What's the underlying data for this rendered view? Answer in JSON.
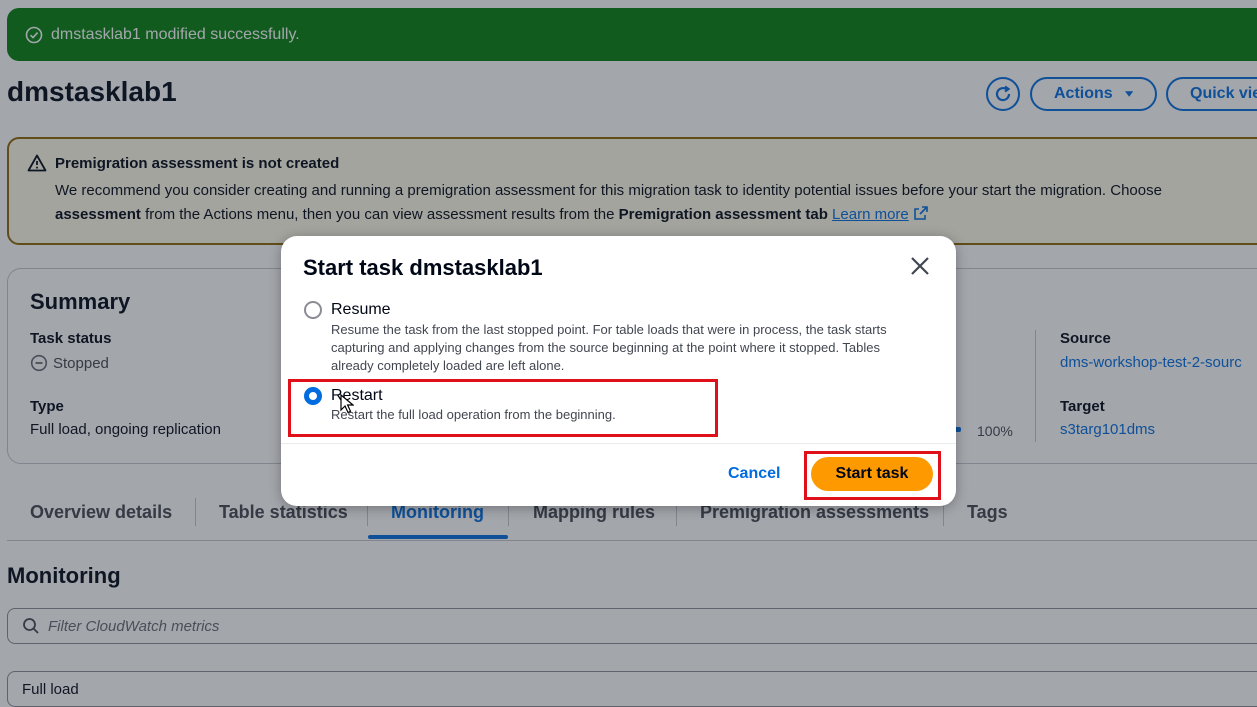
{
  "flash": {
    "message": "dmstasklab1 modified successfully."
  },
  "header": {
    "title": "dmstasklab1",
    "actions_label": "Actions",
    "quick_view_label": "Quick vie"
  },
  "warning": {
    "title": "Premigration assessment is not created",
    "line1": "We recommend you consider creating and running a premigration assessment for this migration task to identity potential issues before your start the migration. Choose",
    "line2_bold_a": "assessment",
    "line2_mid": " from the Actions menu, then you can view assessment results from the ",
    "line2_bold_b": "Premigration assessment tab",
    "line2_link": "Learn more"
  },
  "summary": {
    "title": "Summary",
    "task_status_label": "Task status",
    "task_status_value": "Stopped",
    "type_label": "Type",
    "type_value": "Full load, ongoing replication",
    "progress_value": "100%",
    "source_label": "Source",
    "source_value": "dms-workshop-test-2-sourc",
    "target_label": "Target",
    "target_value": "s3targ101dms"
  },
  "tabs": [
    {
      "label": "Overview details"
    },
    {
      "label": "Table statistics"
    },
    {
      "label": "Monitoring"
    },
    {
      "label": "Mapping rules"
    },
    {
      "label": "Premigration assessments"
    },
    {
      "label": "Tags"
    }
  ],
  "monitoring": {
    "title": "Monitoring",
    "filter_placeholder": "Filter CloudWatch metrics",
    "select_value": "Full load"
  },
  "modal": {
    "title": "Start task dmstasklab1",
    "options": [
      {
        "label": "Resume",
        "desc1": "Resume the task from the last stopped point. For table loads that were in process, the task starts",
        "desc2": "capturing and applying changes from the source beginning at the point where it stopped. Tables",
        "desc3": "already completely loaded are left alone.",
        "selected": false
      },
      {
        "label": "Restart",
        "desc1": "Restart the full load operation from the beginning.",
        "selected": true
      }
    ],
    "cancel_label": "Cancel",
    "start_label": "Start task"
  },
  "colors": {
    "accent": "#006ce0",
    "success": "#037f0c",
    "primary_button": "#ff9900",
    "highlight": "#e0101b"
  }
}
